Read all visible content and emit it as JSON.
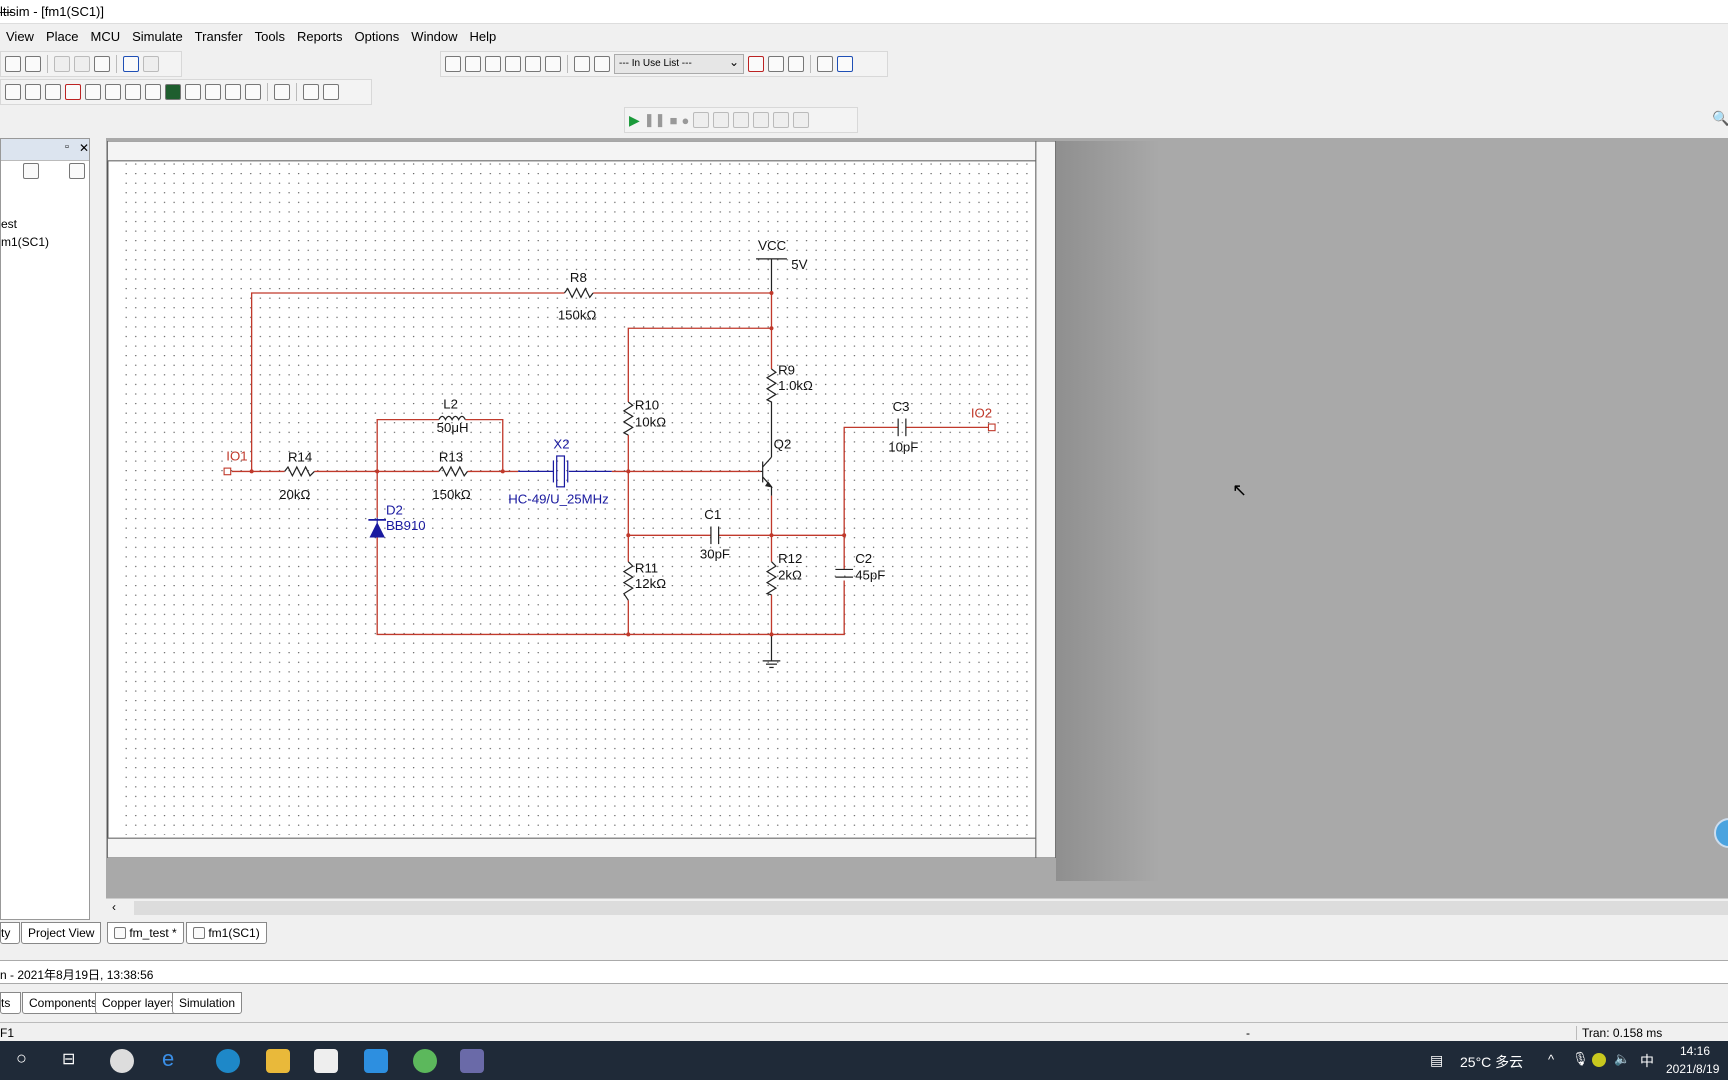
{
  "window": {
    "title": "ltisim - [fm1(SC1)]"
  },
  "menu": [
    "View",
    "Place",
    "MCU",
    "Simulate",
    "Transfer",
    "Tools",
    "Reports",
    "Options",
    "Window",
    "Help"
  ],
  "toolbar": {
    "in_use_list": "--- In Use List ---"
  },
  "left_panel": {
    "items": [
      "est",
      "m1(SC1)"
    ],
    "tabs": [
      "ty",
      "Project View"
    ]
  },
  "doc_tabs": [
    "fm_test *",
    "fm1(SC1)"
  ],
  "schematic": {
    "wire_color": "#c0392b",
    "text_blue": "#1a1aa0",
    "parts": {
      "vcc": {
        "name": "VCC",
        "value": "5V"
      },
      "r8": {
        "name": "R8",
        "value": "150kΩ"
      },
      "r9": {
        "name": "R9",
        "value": "1.0kΩ"
      },
      "r10": {
        "name": "R10",
        "value": "10kΩ"
      },
      "r11": {
        "name": "R11",
        "value": "12kΩ"
      },
      "r12": {
        "name": "R12",
        "value": "2kΩ"
      },
      "r13": {
        "name": "R13",
        "value": "150kΩ"
      },
      "r14": {
        "name": "R14",
        "value": "20kΩ"
      },
      "l2": {
        "name": "L2",
        "value": "50μH"
      },
      "c1": {
        "name": "C1",
        "value": "30pF"
      },
      "c2": {
        "name": "C2",
        "value": "45pF"
      },
      "c3": {
        "name": "C3",
        "value": "10pF"
      },
      "x2": {
        "name": "X2",
        "value": "HC-49/U_25MHz"
      },
      "d2": {
        "name": "D2",
        "value": "BB910"
      },
      "q2": {
        "name": "Q2"
      },
      "io1": {
        "name": "IO1"
      },
      "io2": {
        "name": "IO2"
      }
    }
  },
  "output": {
    "line": "n  -  2021年8月19日, 13:38:56"
  },
  "bottom_tabs": [
    "ts",
    "Components",
    "Copper layers",
    "Simulation"
  ],
  "status": {
    "left": "F1",
    "middle": "-",
    "right": "Tran: 0.158 ms"
  },
  "taskbar": {
    "weather": "25°C 多云",
    "ime": "中",
    "time": "14:16",
    "date": "2021/8/19"
  }
}
